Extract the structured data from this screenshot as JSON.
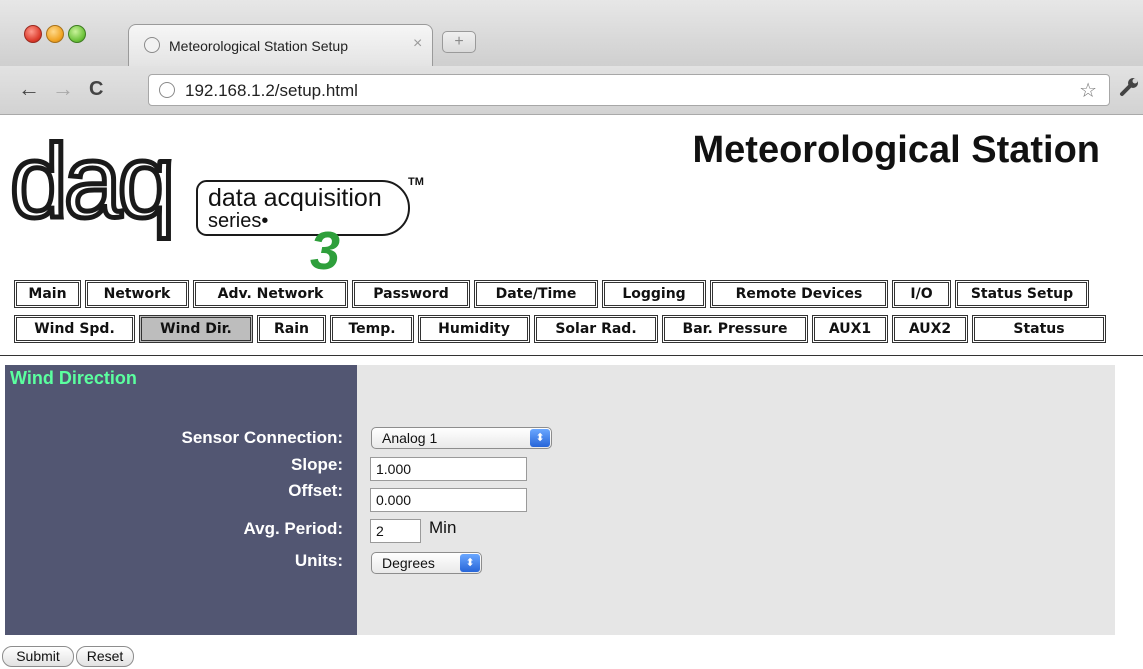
{
  "browser": {
    "tab_title": "Meteorological Station Setup",
    "tab_close": "×",
    "new_tab": "+",
    "back": "←",
    "forward": "→",
    "reload": "C",
    "url": "192.168.1.2/setup.html",
    "star": "☆",
    "wrench": "🔧"
  },
  "logo": {
    "brand": "daq",
    "line1": "data acquisition",
    "line2": "series•",
    "tm": "TM",
    "number": "3"
  },
  "site_title": "Meteorological Station",
  "nav_row1": [
    "Main",
    "Network",
    "Adv. Network",
    "Password",
    "Date/Time",
    "Logging",
    "Remote Devices",
    "I/O",
    "Status Setup"
  ],
  "nav_row2": [
    "Wind Spd.",
    "Wind Dir.",
    "Rain",
    "Temp.",
    "Humidity",
    "Solar Rad.",
    "Bar. Pressure",
    "AUX1",
    "AUX2",
    "Status"
  ],
  "active_nav": "Wind Dir.",
  "form": {
    "heading": "Wind Direction",
    "sensor_connection_label": "Sensor Connection:",
    "sensor_connection_value": "Analog 1",
    "slope_label": "Slope:",
    "slope_value": "1.000",
    "offset_label": "Offset:",
    "offset_value": "0.000",
    "avg_period_label": "Avg. Period:",
    "avg_period_value": "2",
    "avg_period_unit": "Min",
    "units_label": "Units:",
    "units_value": "Degrees",
    "select_arrow": "⬍"
  },
  "buttons": {
    "submit": "Submit",
    "reset": "Reset"
  },
  "colors": {
    "panel_left": "#525672",
    "panel_right": "#e6e6e6",
    "heading": "#5bff9f",
    "active_tab": "#bdbdbd",
    "logo_green": "#2e9f3b"
  }
}
